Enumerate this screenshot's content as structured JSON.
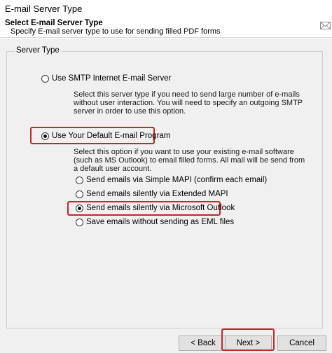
{
  "window": {
    "title": "E-mail Server Type"
  },
  "header": {
    "title": "Select E-mail Server Type",
    "subtitle": "Specify E-mail server type to use for sending filled PDF forms",
    "icon": "envelope-icon"
  },
  "group": {
    "label": "Server Type",
    "options": [
      {
        "label": "Use SMTP Internet E-mail Server",
        "checked": false,
        "description": "Select this server type if you need to send large number of e-mails\nwithout user interaction. You will need to specify an outgoing SMTP\nserver in order to use this option."
      },
      {
        "label": "Use Your Default E-mail Program",
        "checked": true,
        "description": "Select this option if you want to use your existing e-mail software\n(such as MS Outlook) to email filled forms. All mail will be send from\na default user account."
      }
    ],
    "sub_options": [
      {
        "label": "Send emails via Simple MAPI (confirm each email)",
        "checked": false
      },
      {
        "label": "Send emails silently via Extended MAPI",
        "checked": false
      },
      {
        "label": "Send emails silently via Microsoft Outlook",
        "checked": true
      },
      {
        "label": "Save emails without sending as EML files",
        "checked": false
      }
    ]
  },
  "footer": {
    "back_label": "< Back",
    "next_label": "Next >",
    "cancel_label": "Cancel"
  },
  "colors": {
    "highlight": "#c2272d",
    "panel": "#f0f0f0"
  }
}
